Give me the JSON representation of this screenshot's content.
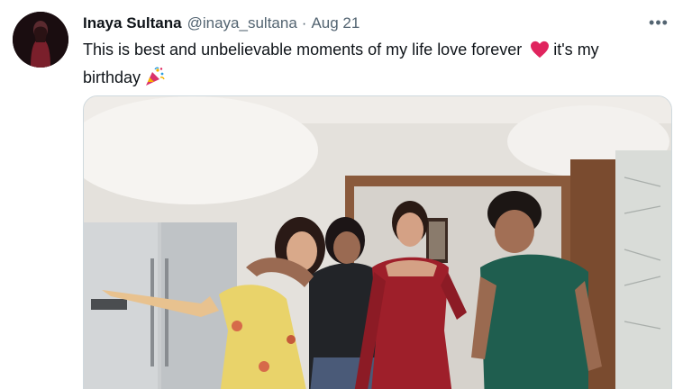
{
  "tweet": {
    "author_name": "Inaya Sultana",
    "author_handle": "@inaya_sultana",
    "separator": "·",
    "date": "Aug 21",
    "more_label": "•••",
    "text_part1": "This is best and unbelievable moments of my life love forever",
    "text_part2": "it's my birthday",
    "emojis": [
      "red-heart-icon",
      "party-popper-icon"
    ]
  },
  "media": {
    "type": "photo",
    "description_icon": "group-photo"
  },
  "colors": {
    "name": "#0f1419",
    "secondary": "#536471",
    "border": "#cfd9de",
    "heart": "#e0245e"
  }
}
